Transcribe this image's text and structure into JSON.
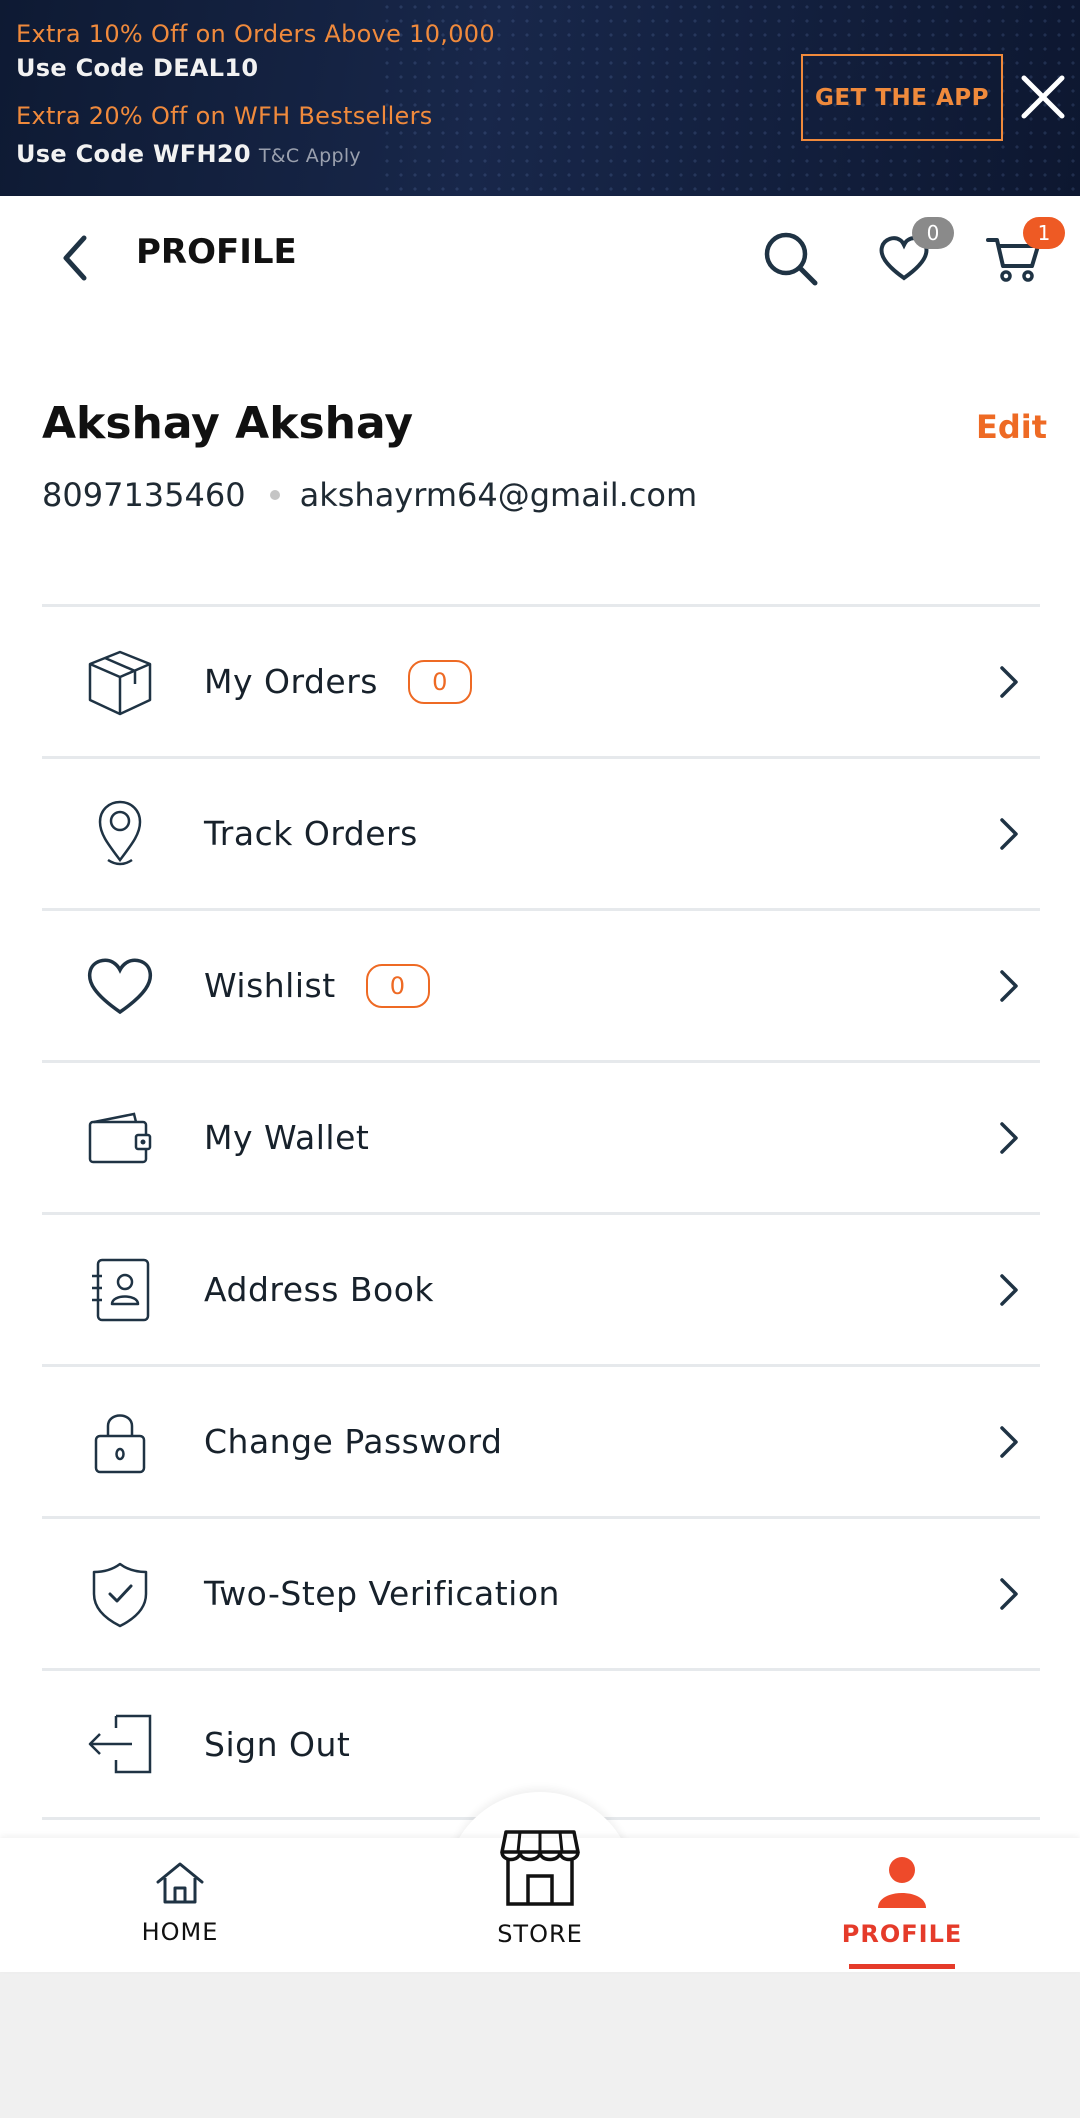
{
  "promo": {
    "line1": "Extra 10% Off on Orders Above 10,000",
    "line2": "Use Code DEAL10",
    "line3": "Extra 20% Off on WFH Bestsellers",
    "line4": "Use Code WFH20",
    "tc": "T&C Apply",
    "cta": "GET THE APP",
    "close_icon": "close-icon"
  },
  "header": {
    "title": "PROFILE",
    "wishlist_count": "0",
    "cart_count": "1"
  },
  "profile": {
    "name": "Akshay Akshay",
    "edit_label": "Edit",
    "phone": "8097135460",
    "email": "akshayrm64@gmail.com"
  },
  "menu": [
    {
      "label": "My Orders",
      "count": "0",
      "icon": "box-icon"
    },
    {
      "label": "Track Orders",
      "icon": "location-pin-icon"
    },
    {
      "label": "Wishlist",
      "count": "0",
      "icon": "heart-icon"
    },
    {
      "label": "My Wallet",
      "icon": "wallet-icon"
    },
    {
      "label": "Address Book",
      "icon": "address-book-icon"
    },
    {
      "label": "Change Password",
      "icon": "lock-icon"
    },
    {
      "label": "Two-Step Verification",
      "icon": "shield-check-icon"
    },
    {
      "label": "Sign Out",
      "icon": "sign-out-icon"
    }
  ],
  "bottom_nav": {
    "home": "HOME",
    "store": "STORE",
    "profile": "PROFILE",
    "active": "profile"
  },
  "colors": {
    "accent": "#ee6a24",
    "active_nav": "#e53b2a",
    "banner_bg": "#0e1a33"
  }
}
